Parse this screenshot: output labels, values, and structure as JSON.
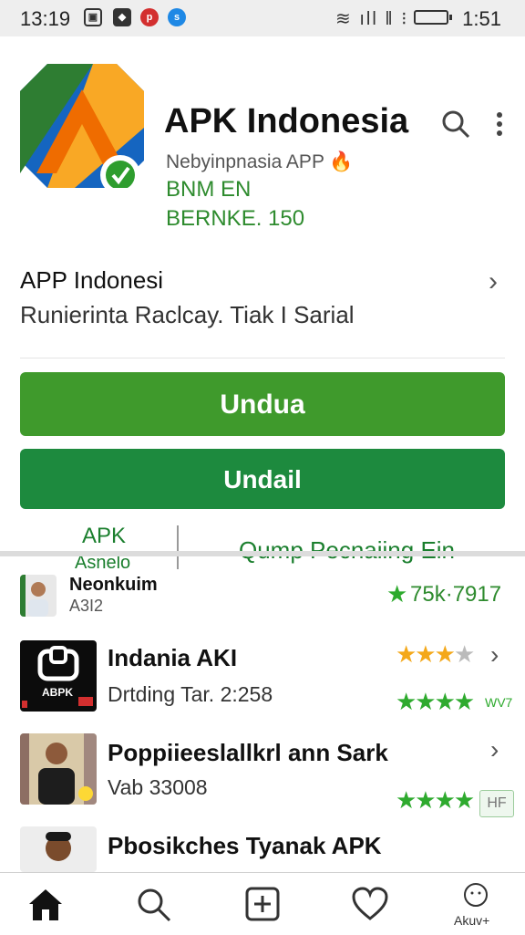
{
  "status": {
    "time": "13:19",
    "clock": "1:51",
    "icons": [
      "gallery-icon",
      "app-icon",
      "pinterest-icon",
      "shazam-icon"
    ],
    "sys": "WiFi signal battery"
  },
  "app": {
    "title": "APK Indonesia",
    "developer": "Nebyinpnasia APP",
    "meta1": "BNM EN",
    "meta2": "BERNKE. 150"
  },
  "info_row": {
    "title": "APP Indonesi",
    "subtitle": "Runierinta Raclcay. Tiak I Sarial"
  },
  "buttons": {
    "primary": "Undua",
    "secondary": "Undail"
  },
  "apk": {
    "label": "APK",
    "sub": "Asnelo",
    "link": "Qump Pecnaiing Ein"
  },
  "list": [
    {
      "title": "Neonkuim",
      "subtitle": "A3I2",
      "rating_text": "75k·7917"
    },
    {
      "title": "Indania AKI",
      "subtitle": "Drtding Tar. 2:258",
      "small": "WV7"
    },
    {
      "title": "Poppiieeslallkrl ann Sark",
      "subtitle": "Vab 33008",
      "badge": "HF"
    },
    {
      "title": "Pbosikches Tyanak APK",
      "subtitle": ""
    }
  ],
  "apbk_logo": "ABPK",
  "nav": {
    "last_label": "Akuv+"
  },
  "colors": {
    "accent": "#3f9a2c",
    "dark_green": "#1d8a3e",
    "star_gold": "#f4a81a",
    "star_green": "#2eaa2e"
  }
}
